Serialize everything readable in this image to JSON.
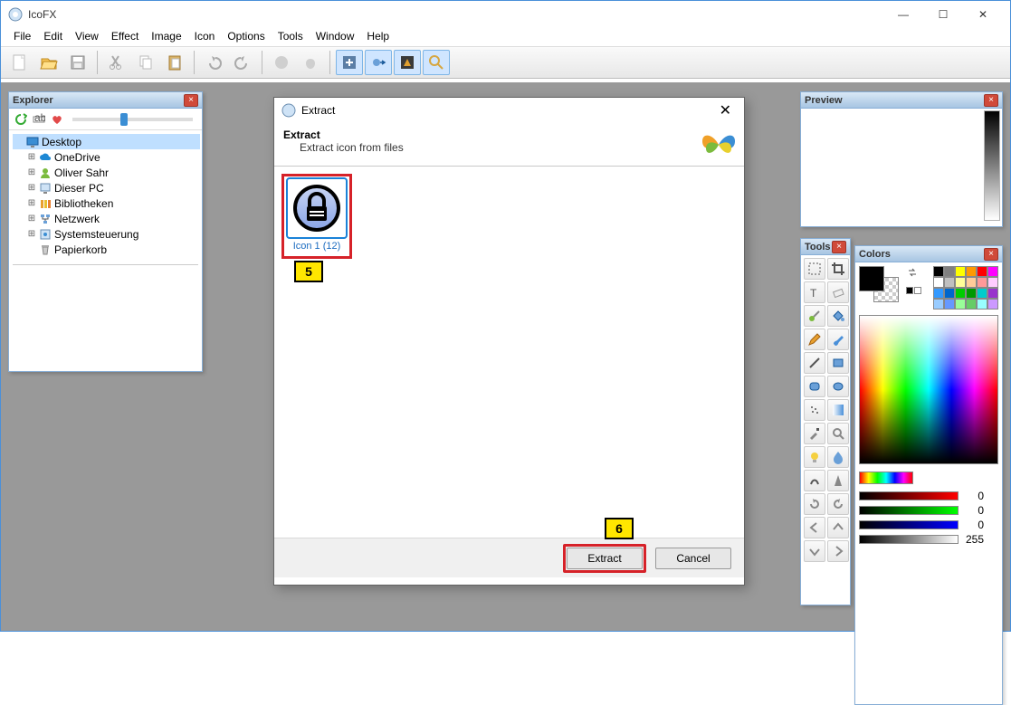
{
  "app": {
    "title": "IcoFX"
  },
  "menu": [
    "File",
    "Edit",
    "View",
    "Effect",
    "Image",
    "Icon",
    "Options",
    "Tools",
    "Window",
    "Help"
  ],
  "explorer": {
    "title": "Explorer",
    "tree": [
      {
        "label": "Desktop",
        "icon": "desktop",
        "level": 0,
        "selected": true,
        "expander": ""
      },
      {
        "label": "OneDrive",
        "icon": "cloud",
        "level": 1,
        "expander": "+"
      },
      {
        "label": "Oliver Sahr",
        "icon": "user",
        "level": 1,
        "expander": "+"
      },
      {
        "label": "Dieser PC",
        "icon": "pc",
        "level": 1,
        "expander": "+"
      },
      {
        "label": "Bibliotheken",
        "icon": "library",
        "level": 1,
        "expander": "+"
      },
      {
        "label": "Netzwerk",
        "icon": "network",
        "level": 1,
        "expander": "+"
      },
      {
        "label": "Systemsteuerung",
        "icon": "control",
        "level": 1,
        "expander": "+"
      },
      {
        "label": "Papierkorb",
        "icon": "trash",
        "level": 1,
        "expander": ""
      }
    ]
  },
  "dialog": {
    "title": "Extract",
    "header_title": "Extract",
    "header_sub": "Extract icon from files",
    "icon_tile_caption": "Icon 1 (12)",
    "extract_btn": "Extract",
    "cancel_btn": "Cancel"
  },
  "callouts": {
    "five": "5",
    "six": "6"
  },
  "preview": {
    "title": "Preview"
  },
  "tools": {
    "title": "Tools"
  },
  "colors": {
    "title": "Colors",
    "r": "0",
    "g": "0",
    "b": "0",
    "a": "255",
    "palette": [
      "#000000",
      "#808080",
      "#ffff00",
      "#ff9900",
      "#ff0000",
      "#ff00ff",
      "#ffffff",
      "#c0c0c0",
      "#ffff99",
      "#ffcc99",
      "#ff9999",
      "#ffccff",
      "#3399ff",
      "#0066cc",
      "#00cc00",
      "#009900",
      "#00cccc",
      "#9933cc",
      "#99ccff",
      "#6699ff",
      "#99ff99",
      "#66cc66",
      "#99ffff",
      "#cc99ff"
    ]
  }
}
